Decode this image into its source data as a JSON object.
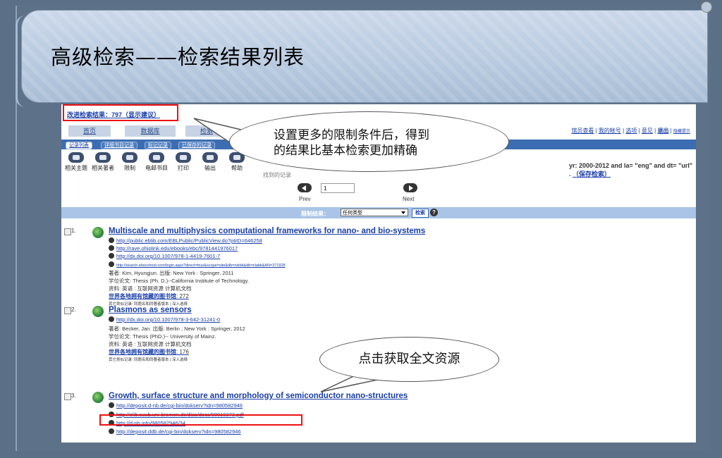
{
  "slide": {
    "title": "高级检索——检索结果列表",
    "callout_top": [
      "设置更多的限制条件后，得到",
      "的结果比基本检索更加精确"
    ],
    "callout_bottom": "点击获取全文资源"
  },
  "screenshot": {
    "results_header": "改进检索结果：797（显示建议）",
    "tabs": [
      "首页",
      "数据库",
      "检索"
    ],
    "top_links": [
      "馆员查看",
      "我的帐号",
      "选项",
      "意见",
      "退出",
      "隐藏提示"
    ],
    "subtabs": [
      "记录列表",
      "详细书目记录",
      "标记记录",
      "已保存的记录"
    ],
    "toolbar": [
      "相关主题",
      "相关著者",
      "限制",
      "电邮书目",
      "打印",
      "输出",
      "帮助"
    ],
    "query_text": "yr: 2000-2012 and la= \"eng\" and dt= \"url\" .",
    "save_search": "（保存检索）",
    "found_text": "找到的记录",
    "pager": {
      "page": "1",
      "prev": "Prev",
      "next": "Next"
    },
    "filter": {
      "label": "限制结果：",
      "value": "任何类型",
      "button": "检索",
      "help": "?"
    },
    "records": [
      {
        "num": "1.",
        "title": "Multiscale and multiphysics computational frameworks for nano- and bio-systems",
        "links": [
          "http://public.eblib.com/EBLPublic/PublicView.do?ptiID=646258",
          "http://rave.ohiolink.edu/ebooks/ebc/9781441976017",
          "http://dx.doi.org/10.1007/978-1-4419-7601-7",
          "http://search.ebscohost.com/login.aspx?direct=true&scope=site&db=nlebk&db=nlabk&AN=371928"
        ],
        "author": "著者: Kim, Hyungjun.  出版: New York : Springer, 2011",
        "thesis": "学位论文: Thesis (Ph. D.)--California Institute of Technology.",
        "resource": "资料: 英语 : 互联网资源  计算机文档",
        "holdings_label": "世界各地拥有馆藏的图书馆",
        "holdings_count": ": 272",
        "other": "其它类似记录: 同题名和同著者版本 | 深入选择"
      },
      {
        "num": "2.",
        "title": "Plasmons as sensors",
        "links": [
          "http://dx.doi.org/10.1007/978-3-642-31241-0"
        ],
        "author": "著者: Becker, Jan.  出版: Berlin ; New York : Springer, 2012",
        "thesis": "学位论文: Thesis (PhD.)-- University of Mainz.",
        "resource": "资料: 英语 : 互联网资源  计算机文档",
        "holdings_label": "世界各地拥有馆藏的图书馆",
        "holdings_count": ": 176",
        "other": "其它类似记录: 同题名和同著者版本 | 深入选择"
      },
      {
        "num": "3.",
        "title": "Growth, surface structure and morphology of semiconductor nano-structures",
        "links": [
          "http://deposit.d-nb.de/cgi-bin/dokserv?idn=980582946",
          "http://elib.suub.uni-bremen.de/diss/docs/00010373.pdf",
          "http://d-nb.info/980582946/34",
          "http://deposit.ddb.de/cgi-bin/dokserv?idn=980582946"
        ]
      }
    ]
  },
  "colors": {
    "highlight": "#e11111",
    "link": "#1a3fa8",
    "bar": "#3c6db3"
  }
}
